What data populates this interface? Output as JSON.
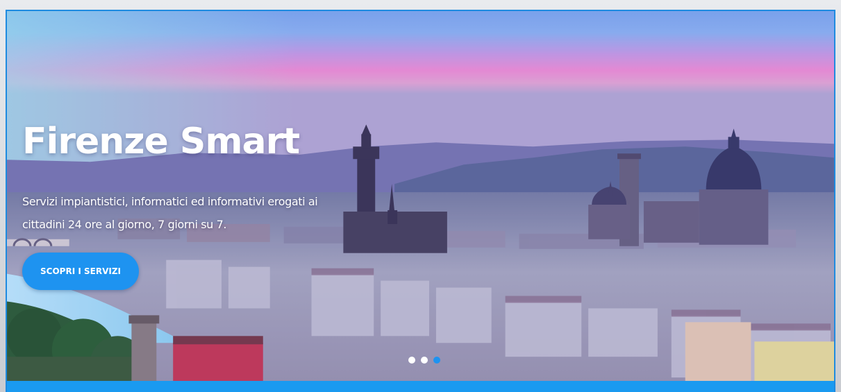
{
  "hero": {
    "title": "Firenze Smart",
    "subtitle": "Servizi impiantistici, informatici ed informativi erogati ai cittadini 24 ore al giorno, 7 giorni su 7.",
    "cta_label": "SCOPRI I SERVIZI"
  },
  "carousel": {
    "slide_count": 3,
    "active_index": 2
  },
  "colors": {
    "accent": "#1e93f0",
    "bottom_bar": "#1a9af0",
    "text": "#ffffff"
  }
}
